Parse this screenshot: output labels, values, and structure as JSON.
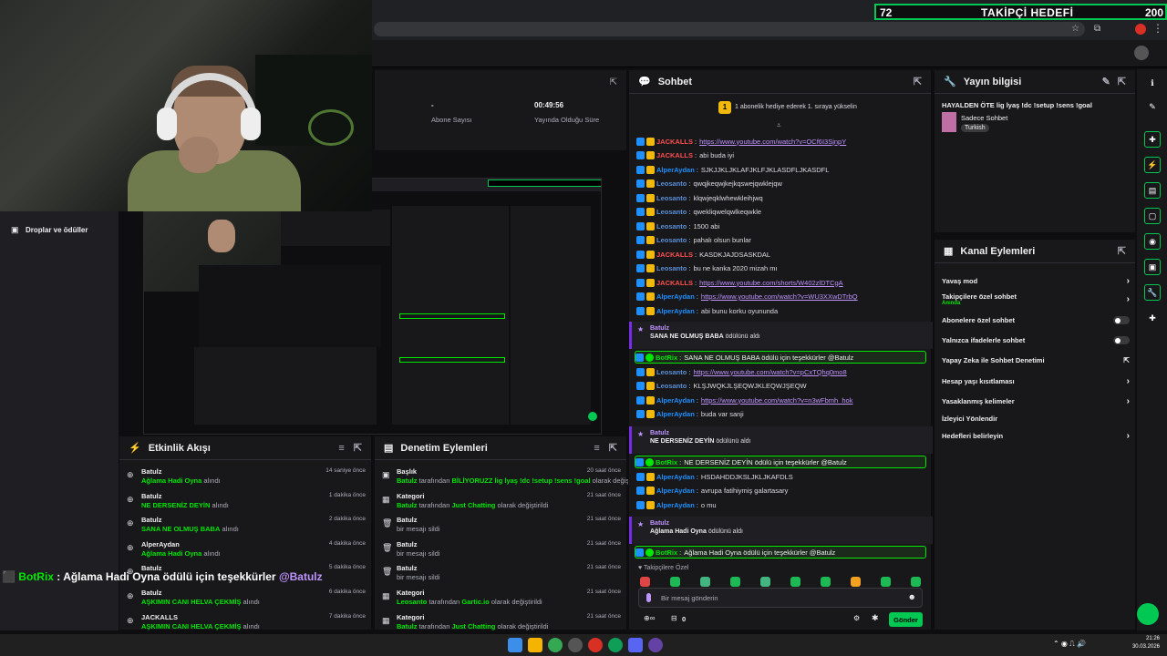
{
  "goal": {
    "current": "72",
    "title": "TAKİPÇİ HEDEFİ",
    "target": "200"
  },
  "stats": {
    "subs_value": "-",
    "subs_label": "Abone Sayısı",
    "uptime_value": "00:49:56",
    "uptime_label": "Yayında Olduğu Süre"
  },
  "leftnav": {
    "item1": "Droplar ve ödüller"
  },
  "chat": {
    "title": "Sohbet",
    "hype": "1 abonelik hediye ederek 1. sıraya yükselin",
    "lines": [
      {
        "user": "JACKALLS",
        "color": "#ff4f4f",
        "text": "https://www.youtube.com/watch?v=OCf6I3SjnpY",
        "link": true
      },
      {
        "user": "JACKALLS",
        "color": "#ff4f4f",
        "text": "abi buda iyi",
        "link": false
      },
      {
        "user": "AlperAydan",
        "color": "#1e90ff",
        "text": "SJKJJKLJKLAFJKLFJKLASDFLJKASDFL",
        "link": false
      },
      {
        "user": "Leosanto",
        "color": "#5a8ed6",
        "text": "qwqjkeqwjkejkqswejqwklejqw",
        "link": false
      },
      {
        "user": "Leosanto",
        "color": "#5a8ed6",
        "text": "klqwjeqklwhewkleihjwq",
        "link": false
      },
      {
        "user": "Leosanto",
        "color": "#5a8ed6",
        "text": "qwekliqwelqwlkeqwkle",
        "link": false
      },
      {
        "user": "Leosanto",
        "color": "#5a8ed6",
        "text": "1500 abi",
        "link": false
      },
      {
        "user": "Leosanto",
        "color": "#5a8ed6",
        "text": "pahalı olsun bunlar",
        "link": false
      },
      {
        "user": "JACKALLS",
        "color": "#ff4f4f",
        "text": "KASDKJAJDSASKDAL",
        "link": false
      },
      {
        "user": "Leosanto",
        "color": "#5a8ed6",
        "text": "bu ne kanka 2020 mizah mı",
        "link": false
      },
      {
        "user": "JACKALLS",
        "color": "#ff4f4f",
        "text": "https://www.youtube.com/shorts/W402zlDTCgA",
        "link": true
      },
      {
        "user": "AlperAydan",
        "color": "#1e90ff",
        "text": "https://www.youtube.com/watch?v=WU3XXwDTrbQ",
        "link": true
      },
      {
        "user": "AlperAydan",
        "color": "#1e90ff",
        "text": "abi bunu korku oyununda",
        "link": false
      }
    ],
    "event1": {
      "user": "Batulz",
      "title": "SANA NE OLMUŞ BABA",
      "suffix": "ödülünü aldı"
    },
    "bot1": {
      "user": "BotRix",
      "text": "SANA NE OLMUŞ BABA ödülü için teşekkürler @Batulz"
    },
    "lines2": [
      {
        "user": "Leosanto",
        "color": "#5a8ed6",
        "text": "https://www.youtube.com/watch?v=pCxTQhq0mo8",
        "link": true
      },
      {
        "user": "Leosanto",
        "color": "#5a8ed6",
        "text": "KLŞJWQKJLŞEQWJKLEQWJŞEQW",
        "link": false
      },
      {
        "user": "AlperAydan",
        "color": "#1e90ff",
        "text": "https://www.youtube.com/watch?v=n3wFbmh_hok",
        "link": true
      },
      {
        "user": "AlperAydan",
        "color": "#1e90ff",
        "text": "buda var sanji",
        "link": false
      }
    ],
    "event2": {
      "user": "Batulz",
      "title": "NE DERSENİZ DEYİN",
      "suffix": "ödülünü aldı"
    },
    "bot2": {
      "user": "BotRix",
      "text": "NE DERSENİZ DEYİN ödülü için teşekkürler @Batulz"
    },
    "lines3": [
      {
        "user": "AlperAydan",
        "color": "#1e90ff",
        "text": "HSDAHDDJKSLJKLJKAFDLS",
        "link": false
      },
      {
        "user": "AlperAydan",
        "color": "#1e90ff",
        "text": "avrupa fatihiymiş galartasary",
        "link": false
      },
      {
        "user": "AlperAydan",
        "color": "#1e90ff",
        "text": "o mu",
        "link": false
      }
    ],
    "event3": {
      "user": "Batulz",
      "title": "Ağlama Hadi Oyna",
      "suffix": "ödülünü aldı"
    },
    "bot3": {
      "user": "BotRix",
      "text": "Ağlama Hadi Oyna ödülü için teşekkürler @Batulz"
    },
    "followers_only": "Takipçilere Özel",
    "input_placeholder": "Bir mesaj gönderin",
    "points": "0",
    "send": "Gönder"
  },
  "info": {
    "title": "Yayın bilgisi",
    "stream_title": "HAYALDEN ÖTE lig lyaş !dc !setup !sens !goal",
    "category": "Sadece Sohbet",
    "tag": "Turkish"
  },
  "actions": {
    "title": "Kanal Eylemleri",
    "items": [
      {
        "label": "Yavaş mod",
        "sub": "",
        "type": "chevron"
      },
      {
        "label": "Takipçilere özel sohbet",
        "sub": "Anında",
        "type": "chevron"
      },
      {
        "label": "Abonelere özel sohbet",
        "sub": "",
        "type": "toggle"
      },
      {
        "label": "Yalnızca ifadelerle sohbet",
        "sub": "",
        "type": "toggle"
      },
      {
        "label": "Yapay Zeka ile Sohbet Denetimi",
        "sub": "",
        "type": "external"
      },
      {
        "label": "Hesap yaşı kısıtlaması",
        "sub": "",
        "type": "chevron"
      },
      {
        "label": "Yasaklanmış kelimeler",
        "sub": "",
        "type": "chevron"
      },
      {
        "label": "İzleyici Yönlendir",
        "sub": "",
        "type": "none"
      },
      {
        "label": "Hedefleri belirleyin",
        "sub": "",
        "type": "chevron"
      }
    ]
  },
  "activity": {
    "title": "Etkinlik Akışı",
    "items": [
      {
        "name": "Batulz",
        "reward": "Ağlama Hadi Oyna",
        "suffix": "alındı",
        "time": "14 saniye önce"
      },
      {
        "name": "Batulz",
        "reward": "NE DERSENİZ DEYİN",
        "suffix": "alındı",
        "time": "1 dakika önce"
      },
      {
        "name": "Batulz",
        "reward": "SANA NE OLMUŞ BABA",
        "suffix": "alındı",
        "time": "2 dakika önce"
      },
      {
        "name": "AlperAydan",
        "reward": "Ağlama Hadi Oyna",
        "suffix": "alındı",
        "time": "4 dakika önce"
      },
      {
        "name": "Batulz",
        "reward": "",
        "suffix": "",
        "time": "5 dakika önce"
      },
      {
        "name": "Batulz",
        "reward": "AŞKIMIN CANI HELVA ÇEKMİŞ",
        "suffix": "alındı",
        "time": "6 dakika önce"
      },
      {
        "name": "JACKALLS",
        "reward": "AŞKIMIN CANI HELVA ÇEKMİŞ",
        "suffix": "alındı",
        "time": "7 dakika önce"
      }
    ]
  },
  "moderation": {
    "title": "Denetim Eylemleri",
    "items": [
      {
        "name": "Başlık",
        "by": "Batulz",
        "mid": "tarafından",
        "value": "BİLİYORUZZ lig lyaş !dc !setup !sens !goal",
        "tail": "olarak değiştirildi",
        "time": "20 saat önce",
        "icon": "title-icon"
      },
      {
        "name": "Kategori",
        "by": "Batulz",
        "mid": "tarafından",
        "value": "Just Chatting",
        "tail": "olarak değiştirildi",
        "time": "21 saat önce",
        "icon": "category-icon"
      },
      {
        "name": "Batulz",
        "by": "",
        "mid": "",
        "value": "",
        "tail": "bir mesajı sildi",
        "time": "21 saat önce",
        "icon": "trash-icon"
      },
      {
        "name": "Batulz",
        "by": "",
        "mid": "",
        "value": "",
        "tail": "bir mesajı sildi",
        "time": "21 saat önce",
        "icon": "trash-icon"
      },
      {
        "name": "Batulz",
        "by": "",
        "mid": "",
        "value": "",
        "tail": "bir mesajı sildi",
        "time": "21 saat önce",
        "icon": "trash-icon"
      },
      {
        "name": "Kategori",
        "by": "Leosanto",
        "mid": "tarafından",
        "value": "Gartic.io",
        "tail": "olarak değiştirildi",
        "time": "21 saat önce",
        "icon": "category-icon"
      },
      {
        "name": "Kategori",
        "by": "Batulz",
        "mid": "tarafından",
        "value": "Just Chatting",
        "tail": "olarak değiştirildi",
        "time": "21 saat önce",
        "icon": "category-icon"
      }
    ]
  },
  "overlay": {
    "user": "BotRix",
    "sep": " : ",
    "text": "Ağlama Hadi Oyna ödülü için teşekkürler",
    "mention": "@Batulz"
  },
  "taskbar": {
    "time": "21:26",
    "date": "30.03.2026"
  }
}
